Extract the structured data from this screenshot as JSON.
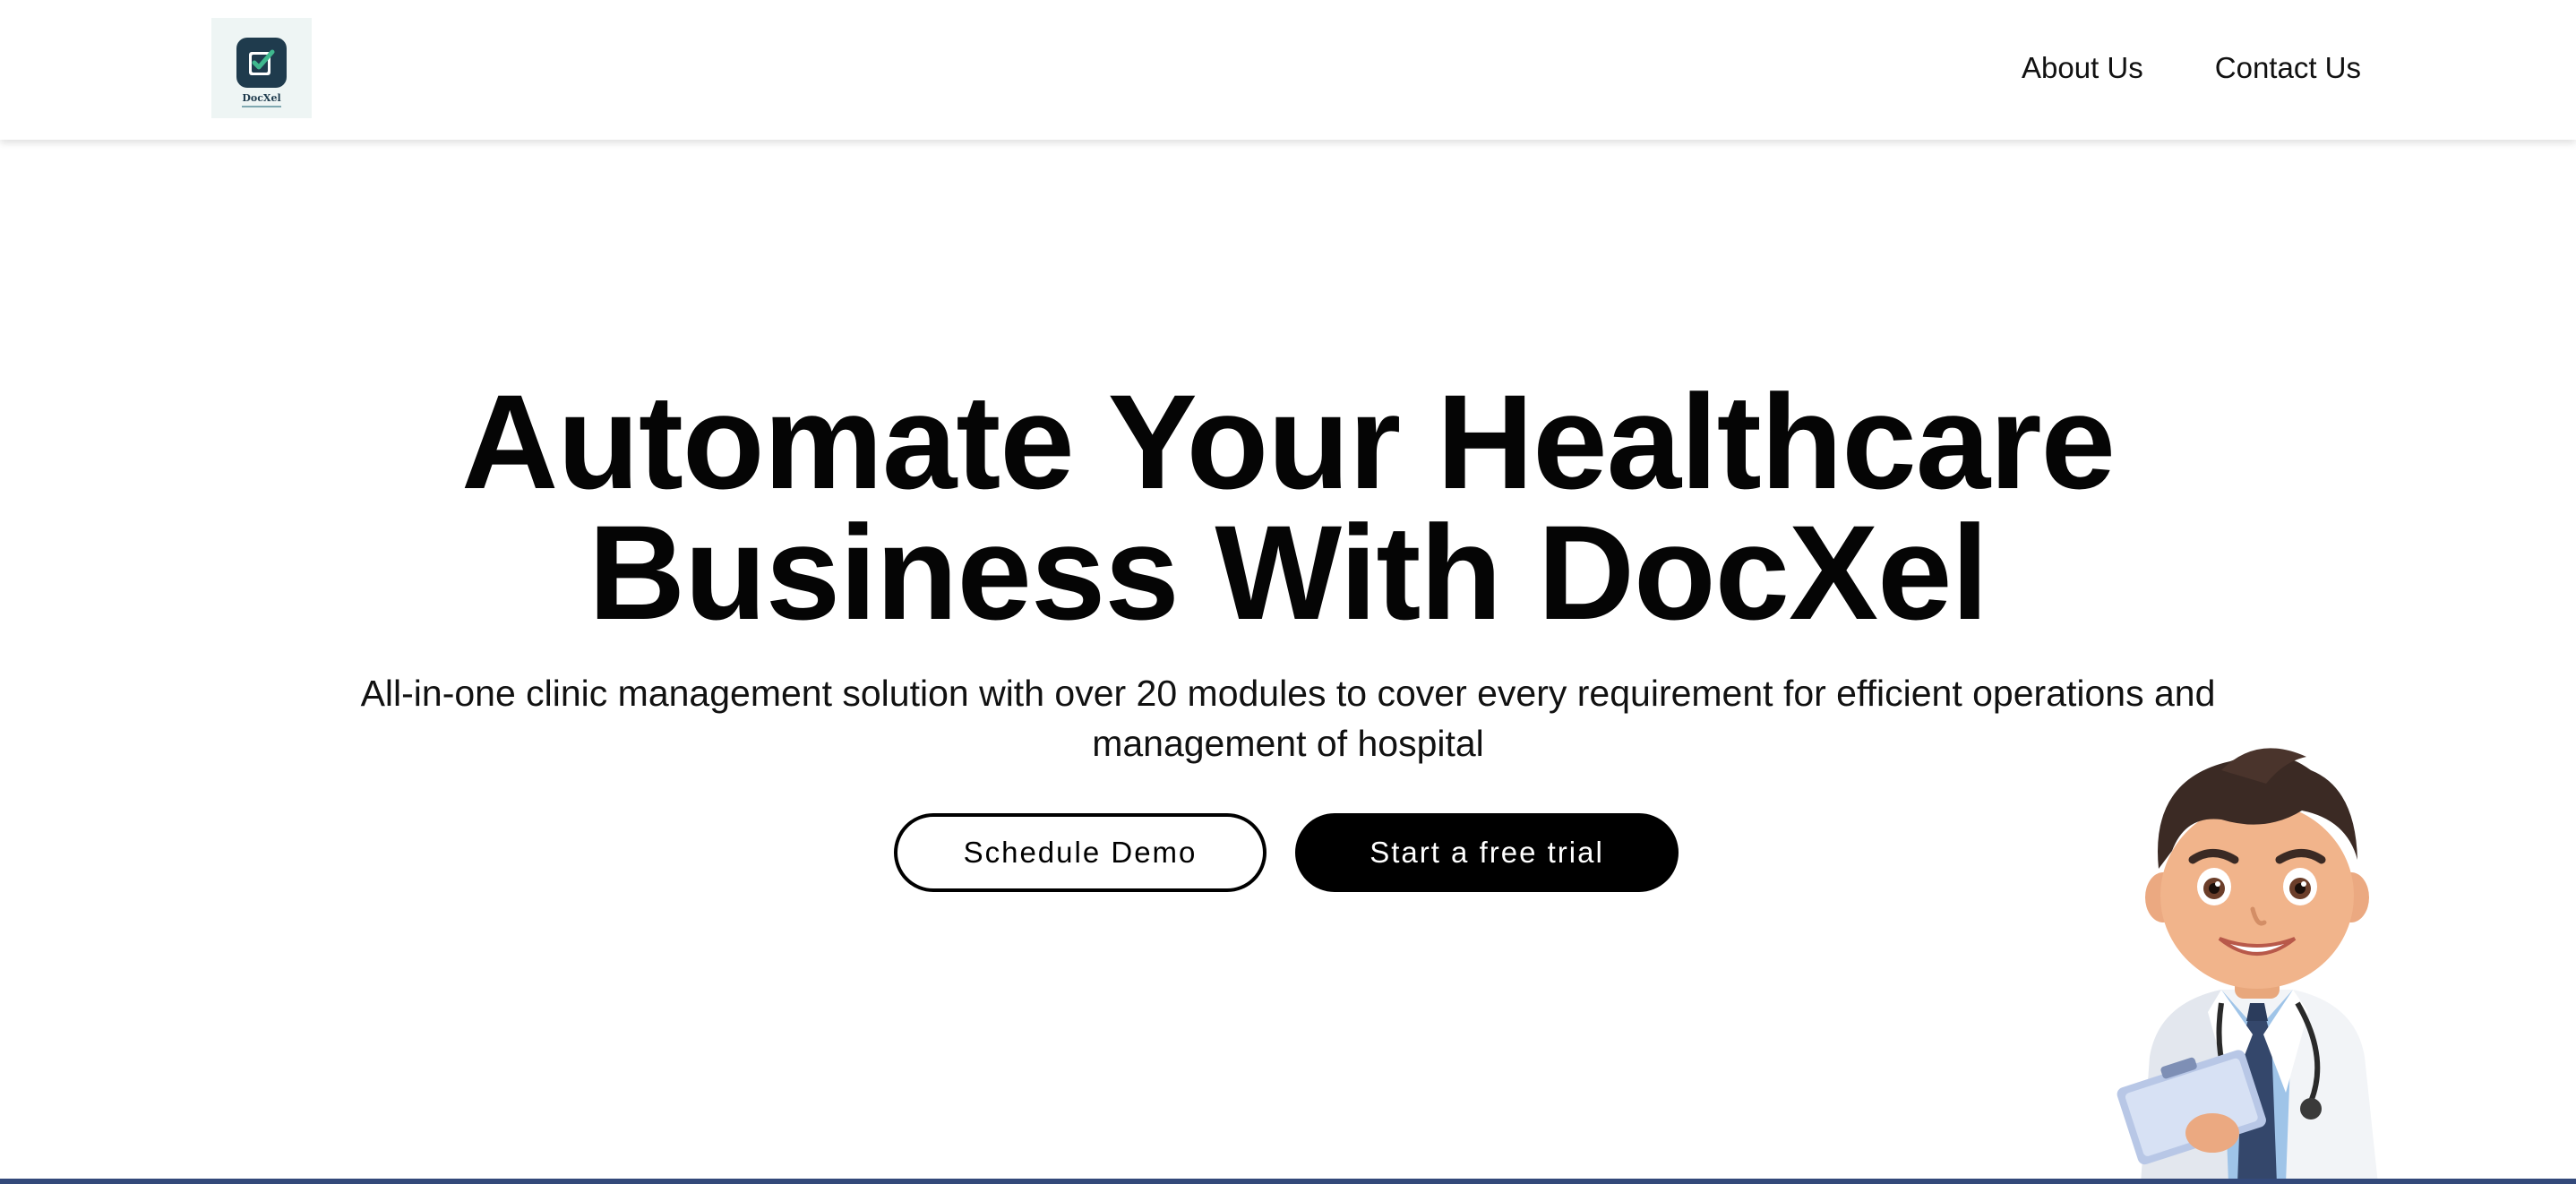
{
  "header": {
    "logo": {
      "icon": "docxel-checklist-icon",
      "text": "DocXel",
      "colors": {
        "mark": "#1f3b4d",
        "check": "#3fb88e",
        "background": "#eef5f4"
      }
    },
    "nav": [
      {
        "label": "About Us"
      },
      {
        "label": "Contact Us"
      }
    ]
  },
  "hero": {
    "title_line1": "Automate Your Healthcare",
    "title_line2": "Business With DocXel",
    "subtitle_line1": "All-in-one clinic management solution with over 20 modules to cover every requirement for efficient operations and",
    "subtitle_line2": "management of hospital",
    "buttons": {
      "schedule_demo": "Schedule Demo",
      "free_trial": "Start a free trial"
    },
    "mascot": "doctor-mascot-illustration"
  },
  "colors": {
    "text": "#050505",
    "primary_button": "#000000",
    "bottom_bar": "#33497a"
  }
}
